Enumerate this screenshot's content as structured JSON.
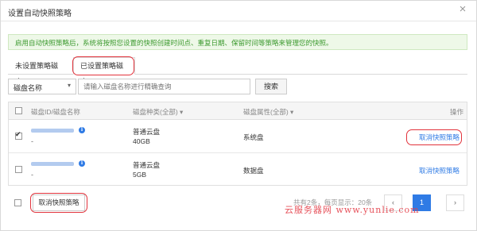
{
  "dialog": {
    "title": "设置自动快照策略",
    "close_symbol": "×"
  },
  "notice": "启用自动快照策略后，系统将按照您设置的快照创建时间点、重复日期、保留时间等策略来管理您的快照。",
  "tabs": [
    {
      "label": "未设置策略磁盘",
      "active": false
    },
    {
      "label": "已设置策略磁盘",
      "active": true
    }
  ],
  "filter": {
    "select_value": "磁盘名称",
    "search_placeholder": "请输入磁盘名称进行精确查询",
    "search_button": "搜索"
  },
  "table": {
    "columns": [
      "磁盘ID/磁盘名称",
      "磁盘种类(全部)",
      "磁盘属性(全部)",
      "操作"
    ],
    "rows": [
      {
        "checked": true,
        "name": "-",
        "type": "普通云盘",
        "size": "40GB",
        "attribute": "系统盘",
        "action": "取消快照策略"
      },
      {
        "checked": false,
        "name": "-",
        "type": "普通云盘",
        "size": "5GB",
        "attribute": "数据盘",
        "action": "取消快照策略"
      }
    ]
  },
  "footer": {
    "bulk_cancel": "取消快照策略",
    "pagination_text": "共有2条，每页显示：20条",
    "current_page": "1",
    "prev": "‹",
    "next": "›"
  },
  "watermark": "云服务器网 www.yunlie.com",
  "colors": {
    "accent": "#2f7be5",
    "highlight": "#e2333c",
    "notice_text": "#3c9a2f"
  }
}
